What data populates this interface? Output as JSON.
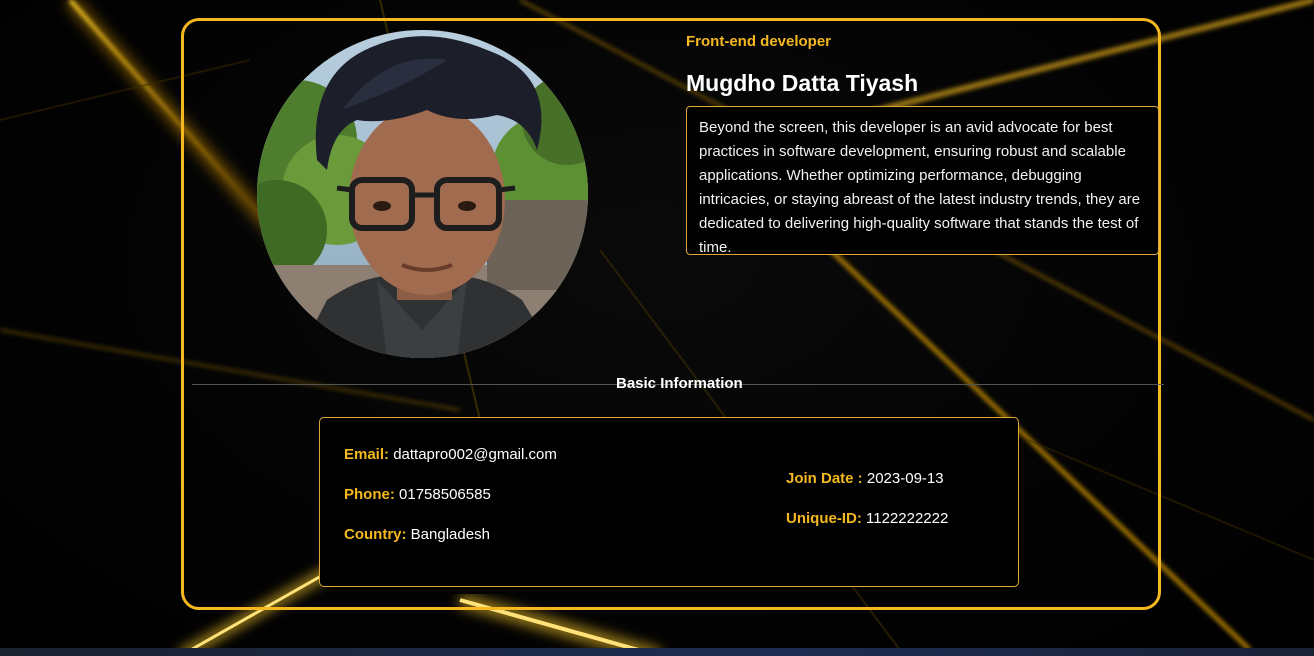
{
  "profile": {
    "role": "Front-end developer",
    "name": "Mugdho Datta Tiyash",
    "bio": "Beyond the screen, this developer is an avid advocate for best practices in software development, ensuring robust and scalable applications. Whether optimizing performance, debugging intricacies, or staying abreast of the latest industry trends, they are dedicated to delivering high-quality software that stands the test of time."
  },
  "basic_info": {
    "title": "Basic Information",
    "email_label": "Email:",
    "email": "dattapro002@gmail.com",
    "phone_label": "Phone:",
    "phone": "01758506585",
    "country_label": "Country:",
    "country": "Bangladesh",
    "join_label": "Join Date :",
    "join_date": "2023-09-13",
    "uid_label": "Unique-ID:",
    "uid": "1122222222"
  },
  "colors": {
    "accent": "#f5b820",
    "background": "#000000",
    "text": "#ffffff"
  },
  "icons": {
    "avatar": "profile-photo"
  }
}
